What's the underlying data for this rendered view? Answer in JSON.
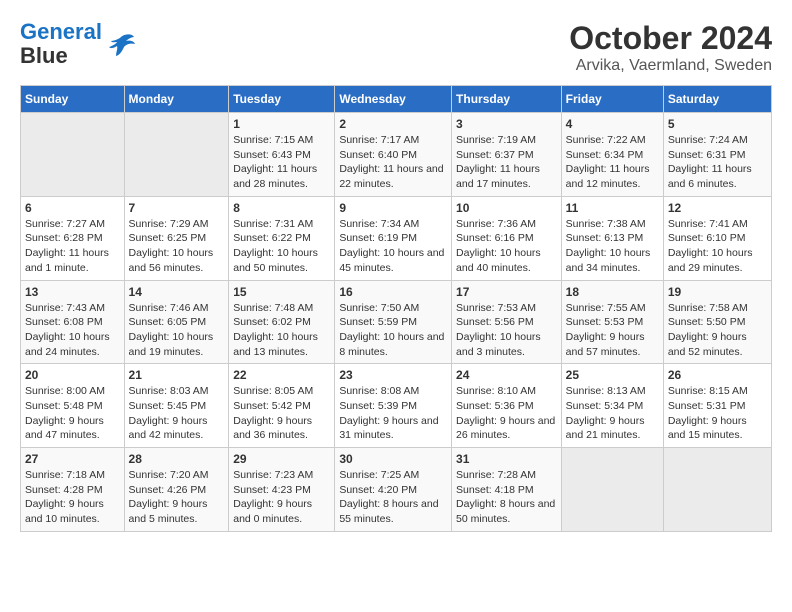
{
  "header": {
    "logo_line1": "General",
    "logo_line2": "Blue",
    "title": "October 2024",
    "subtitle": "Arvika, Vaermland, Sweden"
  },
  "days_of_week": [
    "Sunday",
    "Monday",
    "Tuesday",
    "Wednesday",
    "Thursday",
    "Friday",
    "Saturday"
  ],
  "weeks": [
    [
      {
        "num": "",
        "info": ""
      },
      {
        "num": "",
        "info": ""
      },
      {
        "num": "1",
        "info": "Sunrise: 7:15 AM\nSunset: 6:43 PM\nDaylight: 11 hours and 28 minutes."
      },
      {
        "num": "2",
        "info": "Sunrise: 7:17 AM\nSunset: 6:40 PM\nDaylight: 11 hours and 22 minutes."
      },
      {
        "num": "3",
        "info": "Sunrise: 7:19 AM\nSunset: 6:37 PM\nDaylight: 11 hours and 17 minutes."
      },
      {
        "num": "4",
        "info": "Sunrise: 7:22 AM\nSunset: 6:34 PM\nDaylight: 11 hours and 12 minutes."
      },
      {
        "num": "5",
        "info": "Sunrise: 7:24 AM\nSunset: 6:31 PM\nDaylight: 11 hours and 6 minutes."
      }
    ],
    [
      {
        "num": "6",
        "info": "Sunrise: 7:27 AM\nSunset: 6:28 PM\nDaylight: 11 hours and 1 minute."
      },
      {
        "num": "7",
        "info": "Sunrise: 7:29 AM\nSunset: 6:25 PM\nDaylight: 10 hours and 56 minutes."
      },
      {
        "num": "8",
        "info": "Sunrise: 7:31 AM\nSunset: 6:22 PM\nDaylight: 10 hours and 50 minutes."
      },
      {
        "num": "9",
        "info": "Sunrise: 7:34 AM\nSunset: 6:19 PM\nDaylight: 10 hours and 45 minutes."
      },
      {
        "num": "10",
        "info": "Sunrise: 7:36 AM\nSunset: 6:16 PM\nDaylight: 10 hours and 40 minutes."
      },
      {
        "num": "11",
        "info": "Sunrise: 7:38 AM\nSunset: 6:13 PM\nDaylight: 10 hours and 34 minutes."
      },
      {
        "num": "12",
        "info": "Sunrise: 7:41 AM\nSunset: 6:10 PM\nDaylight: 10 hours and 29 minutes."
      }
    ],
    [
      {
        "num": "13",
        "info": "Sunrise: 7:43 AM\nSunset: 6:08 PM\nDaylight: 10 hours and 24 minutes."
      },
      {
        "num": "14",
        "info": "Sunrise: 7:46 AM\nSunset: 6:05 PM\nDaylight: 10 hours and 19 minutes."
      },
      {
        "num": "15",
        "info": "Sunrise: 7:48 AM\nSunset: 6:02 PM\nDaylight: 10 hours and 13 minutes."
      },
      {
        "num": "16",
        "info": "Sunrise: 7:50 AM\nSunset: 5:59 PM\nDaylight: 10 hours and 8 minutes."
      },
      {
        "num": "17",
        "info": "Sunrise: 7:53 AM\nSunset: 5:56 PM\nDaylight: 10 hours and 3 minutes."
      },
      {
        "num": "18",
        "info": "Sunrise: 7:55 AM\nSunset: 5:53 PM\nDaylight: 9 hours and 57 minutes."
      },
      {
        "num": "19",
        "info": "Sunrise: 7:58 AM\nSunset: 5:50 PM\nDaylight: 9 hours and 52 minutes."
      }
    ],
    [
      {
        "num": "20",
        "info": "Sunrise: 8:00 AM\nSunset: 5:48 PM\nDaylight: 9 hours and 47 minutes."
      },
      {
        "num": "21",
        "info": "Sunrise: 8:03 AM\nSunset: 5:45 PM\nDaylight: 9 hours and 42 minutes."
      },
      {
        "num": "22",
        "info": "Sunrise: 8:05 AM\nSunset: 5:42 PM\nDaylight: 9 hours and 36 minutes."
      },
      {
        "num": "23",
        "info": "Sunrise: 8:08 AM\nSunset: 5:39 PM\nDaylight: 9 hours and 31 minutes."
      },
      {
        "num": "24",
        "info": "Sunrise: 8:10 AM\nSunset: 5:36 PM\nDaylight: 9 hours and 26 minutes."
      },
      {
        "num": "25",
        "info": "Sunrise: 8:13 AM\nSunset: 5:34 PM\nDaylight: 9 hours and 21 minutes."
      },
      {
        "num": "26",
        "info": "Sunrise: 8:15 AM\nSunset: 5:31 PM\nDaylight: 9 hours and 15 minutes."
      }
    ],
    [
      {
        "num": "27",
        "info": "Sunrise: 7:18 AM\nSunset: 4:28 PM\nDaylight: 9 hours and 10 minutes."
      },
      {
        "num": "28",
        "info": "Sunrise: 7:20 AM\nSunset: 4:26 PM\nDaylight: 9 hours and 5 minutes."
      },
      {
        "num": "29",
        "info": "Sunrise: 7:23 AM\nSunset: 4:23 PM\nDaylight: 9 hours and 0 minutes."
      },
      {
        "num": "30",
        "info": "Sunrise: 7:25 AM\nSunset: 4:20 PM\nDaylight: 8 hours and 55 minutes."
      },
      {
        "num": "31",
        "info": "Sunrise: 7:28 AM\nSunset: 4:18 PM\nDaylight: 8 hours and 50 minutes."
      },
      {
        "num": "",
        "info": ""
      },
      {
        "num": "",
        "info": ""
      }
    ]
  ]
}
